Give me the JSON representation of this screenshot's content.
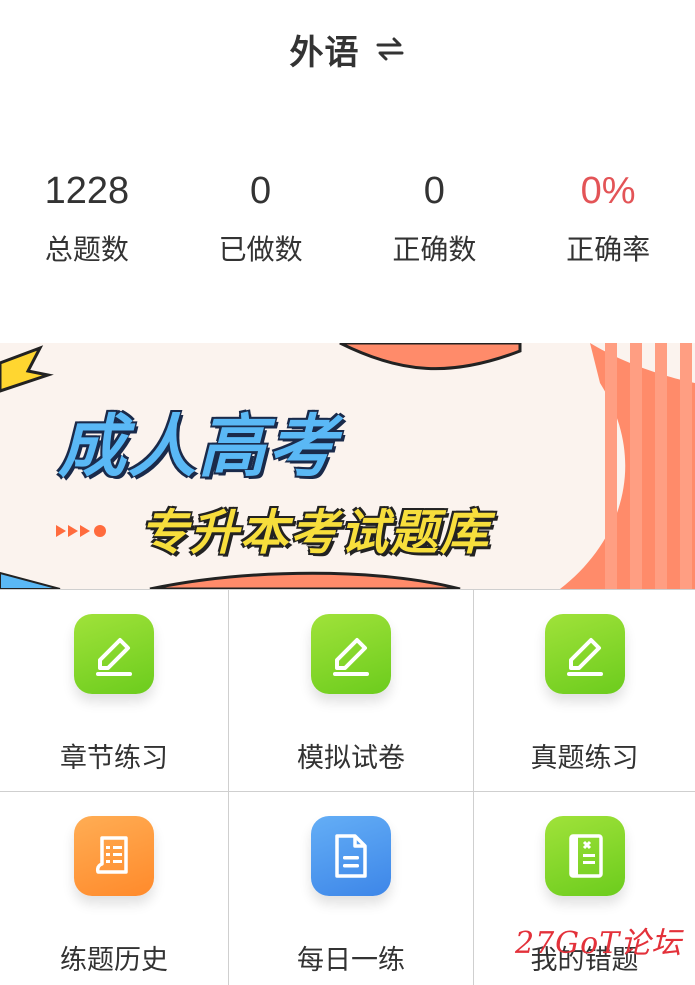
{
  "header": {
    "title": "外语",
    "switch_icon": "swap-arrows-icon"
  },
  "stats": [
    {
      "value": "1228",
      "label": "总题数"
    },
    {
      "value": "0",
      "label": "已做数"
    },
    {
      "value": "0",
      "label": "正确数"
    },
    {
      "value": "0%",
      "label": "正确率",
      "color": "#e35457"
    }
  ],
  "banner": {
    "title": "成人高考",
    "subtitle": "专升本考试题库"
  },
  "menu": [
    {
      "label": "章节练习",
      "icon": "pencil-icon",
      "color": "#7fd62a"
    },
    {
      "label": "模拟试卷",
      "icon": "pencil-icon",
      "color": "#7fd62a"
    },
    {
      "label": "真题练习",
      "icon": "pencil-icon",
      "color": "#7fd62a"
    },
    {
      "label": "练题历史",
      "icon": "scroll-icon",
      "color": "#ff9a3c"
    },
    {
      "label": "每日一练",
      "icon": "document-icon",
      "color": "#4a97ee"
    },
    {
      "label": "我的错题",
      "icon": "notebook-icon",
      "color": "#7fd62a"
    }
  ],
  "watermark": "27GoT论坛"
}
